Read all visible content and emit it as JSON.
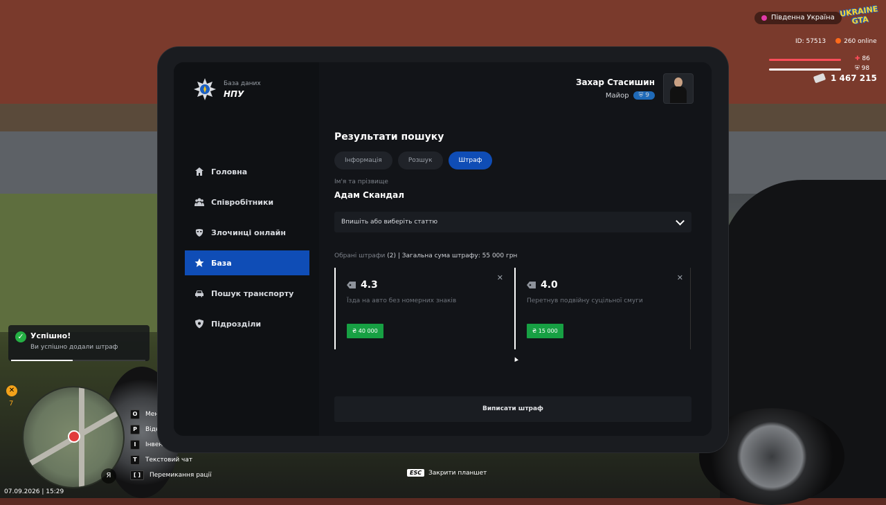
{
  "hud": {
    "region": "Південна Україна",
    "logo_line1": "UKRAINE",
    "logo_line2": "GTA",
    "id": "ID: 57513",
    "online": "260 online",
    "health": "86",
    "armor": "98",
    "money": "1 467 215",
    "health_color": "#ff4d5a",
    "armor_color": "#ffffff"
  },
  "toast": {
    "title": "Успішно!",
    "message": "Ви успішно додали штраф",
    "progress": 0.46
  },
  "hud_bottom": {
    "food_value": "7",
    "date": "07.09.2026 | 15:29",
    "mic_key": "Я",
    "keys": [
      {
        "key": "O",
        "label": "Меню"
      },
      {
        "key": "P",
        "label": "Відкрити"
      },
      {
        "key": "I",
        "label": "Інвентар"
      },
      {
        "key": "T",
        "label": "Текстовий чат"
      },
      {
        "key": "[ ]",
        "label": "Перемикання рації"
      }
    ],
    "esc_key": "ESC",
    "esc_label": "Закрити планшет"
  },
  "app": {
    "brand_sub": "База даних",
    "brand_main": "НПУ",
    "nav": [
      {
        "label": "Головна",
        "icon": "home-icon",
        "active": false
      },
      {
        "label": "Співробітники",
        "icon": "people-icon",
        "active": false
      },
      {
        "label": "Злочинці онлайн",
        "icon": "mask-icon",
        "active": false
      },
      {
        "label": "База",
        "icon": "star-icon",
        "active": true
      },
      {
        "label": "Пошук транспорту",
        "icon": "car-icon",
        "active": false
      },
      {
        "label": "Підрозділи",
        "icon": "shield-icon",
        "active": false
      }
    ],
    "user": {
      "name": "Захар Стасишин",
      "rank": "Майор",
      "level": "9"
    },
    "title": "Результати пошуку",
    "tabs": [
      {
        "label": "Інформація",
        "active": false
      },
      {
        "label": "Розшук",
        "active": false
      },
      {
        "label": "Штраф",
        "active": true
      }
    ],
    "name_label": "Ім'я та прізвище",
    "person_name": "Адам Скандал",
    "select_placeholder": "Впишіть або виберіть статтю",
    "summary_dim": "Обрані штрафи",
    "summary_rest": "(2) | Загальна сума штрафу: 55 000 грн",
    "fines": [
      {
        "article": "4.3",
        "description": "Їзда на авто без номерних знаків",
        "amount": "₴ 40 000"
      },
      {
        "article": "4.0",
        "description": "Перетнув подвійну суцільної смуги",
        "amount": "₴ 15 000"
      }
    ],
    "submit_label": "Виписати штраф",
    "accent": "#0f4db6"
  }
}
